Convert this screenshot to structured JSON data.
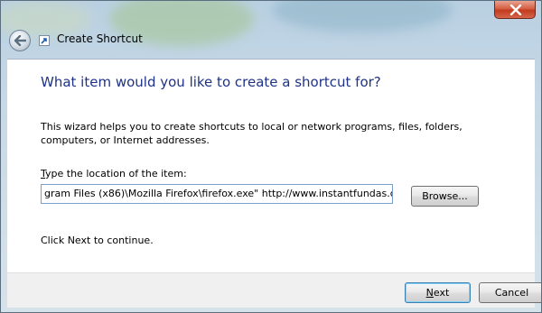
{
  "window": {
    "title": "Create Shortcut"
  },
  "page": {
    "heading": "What item would you like to create a shortcut for?",
    "description": "This wizard helps you to create shortcuts to local or network programs, files, folders, computers, or Internet addresses.",
    "location_label_accel": "T",
    "location_label_rest": "ype the location of the item:",
    "location_value": "gram Files (x86)\\Mozilla Firefox\\firefox.exe\" http://www.instantfundas.com/",
    "browse_label": "Browse...",
    "continue_text": "Click Next to continue."
  },
  "footer": {
    "next_label": "Next",
    "cancel_label": "Cancel"
  },
  "colors": {
    "heading": "#1e3287",
    "close_button": "#c23b1f"
  },
  "icons": [
    "back-arrow-icon",
    "close-icon",
    "shortcut-wizard-icon"
  ]
}
